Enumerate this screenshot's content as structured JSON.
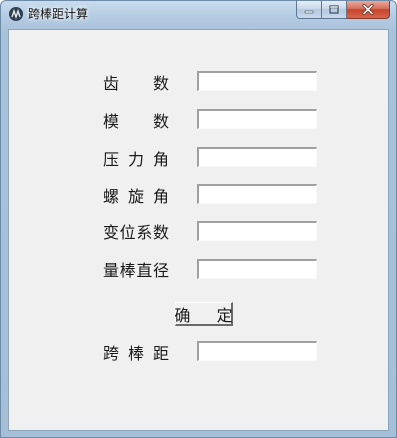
{
  "window": {
    "title": "跨棒距计算",
    "icon": "app-icon"
  },
  "caption": {
    "minimize_icon": "minimize-icon",
    "maximize_icon": "maximize-icon",
    "close_icon": "close-icon"
  },
  "form": {
    "fields": [
      {
        "label_chars": [
          "齿",
          "数"
        ],
        "value": ""
      },
      {
        "label_chars": [
          "模",
          "数"
        ],
        "value": ""
      },
      {
        "label_chars": [
          "压",
          "力",
          "角"
        ],
        "value": ""
      },
      {
        "label_chars": [
          "螺",
          "旋",
          "角"
        ],
        "value": ""
      },
      {
        "label_chars": [
          "变",
          "位",
          "系",
          "数"
        ],
        "value": ""
      },
      {
        "label_chars": [
          "量",
          "棒",
          "直",
          "径"
        ],
        "value": ""
      }
    ],
    "confirm_label": "确  定",
    "result": {
      "label_chars": [
        "跨",
        "棒",
        "距"
      ],
      "value": ""
    }
  },
  "colors": {
    "client_bg": "#f0f0f0",
    "close_button": "#c7442a"
  }
}
